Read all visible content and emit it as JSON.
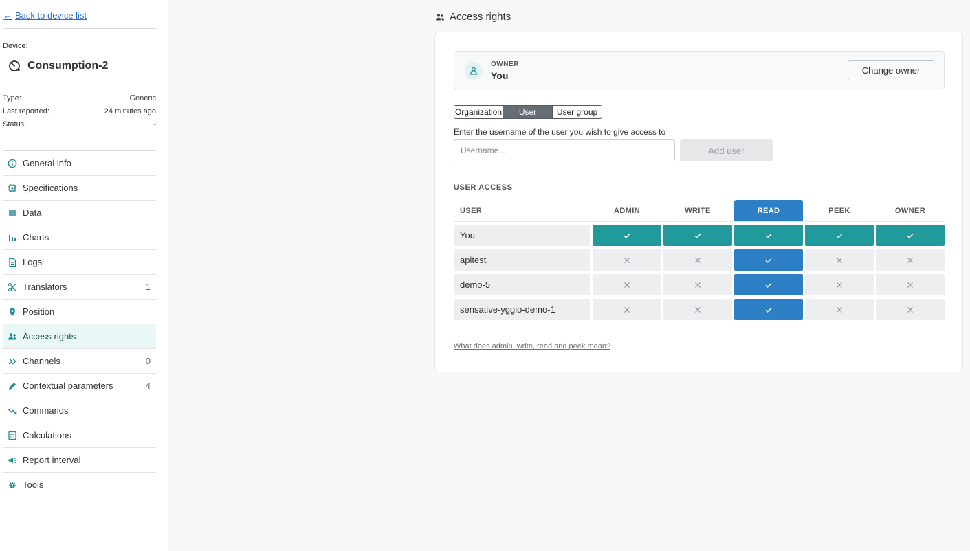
{
  "sidebar": {
    "back_label": "Back to device list",
    "device_label": "Device:",
    "device_name": "Consumption-2",
    "meta": [
      {
        "label": "Type:",
        "value": "Generic"
      },
      {
        "label": "Last reported:",
        "value": "24 minutes ago"
      },
      {
        "label": "Status:",
        "value": "-"
      }
    ],
    "items": [
      {
        "label": "General info",
        "icon": "info-icon",
        "count": ""
      },
      {
        "label": "Specifications",
        "icon": "chip-icon",
        "count": ""
      },
      {
        "label": "Data",
        "icon": "lines-icon",
        "count": ""
      },
      {
        "label": "Charts",
        "icon": "bar-chart-icon",
        "count": ""
      },
      {
        "label": "Logs",
        "icon": "document-icon",
        "count": ""
      },
      {
        "label": "Translators",
        "icon": "scissors-icon",
        "count": "1"
      },
      {
        "label": "Position",
        "icon": "location-pin-icon",
        "count": ""
      },
      {
        "label": "Access rights",
        "icon": "users-icon",
        "count": ""
      },
      {
        "label": "Channels",
        "icon": "double-chevron-icon",
        "count": "0"
      },
      {
        "label": "Contextual parameters",
        "icon": "pencil-icon",
        "count": "4"
      },
      {
        "label": "Commands",
        "icon": "trend-arrow-icon",
        "count": ""
      },
      {
        "label": "Calculations",
        "icon": "calculator-icon",
        "count": ""
      },
      {
        "label": "Report interval",
        "icon": "megaphone-icon",
        "count": ""
      },
      {
        "label": "Tools",
        "icon": "cog-icon",
        "count": ""
      }
    ],
    "active_index": 7
  },
  "main": {
    "section_title": "Access rights",
    "owner": {
      "label": "OWNER",
      "value": "You",
      "change_button": "Change owner"
    },
    "segments": [
      "Organization",
      "User",
      "User group"
    ],
    "active_segment": 1,
    "hint": "Enter the username of the user you wish to give access to",
    "username_placeholder": "Username...",
    "add_button": "Add user",
    "user_access_title": "USER ACCESS",
    "columns": [
      "USER",
      "ADMIN",
      "WRITE",
      "READ",
      "PEEK",
      "OWNER"
    ],
    "selected_column": "READ",
    "rows": [
      {
        "user": "You",
        "admin": true,
        "write": true,
        "read": true,
        "peek": true,
        "owner": true
      },
      {
        "user": "apitest",
        "admin": false,
        "write": false,
        "read": true,
        "peek": false,
        "owner": false
      },
      {
        "user": "demo-5",
        "admin": false,
        "write": false,
        "read": true,
        "peek": false,
        "owner": false
      },
      {
        "user": "sensative-yggio-demo-1",
        "admin": false,
        "write": false,
        "read": true,
        "peek": false,
        "owner": false
      }
    ],
    "help_link": "What does admin, write, read and peek mean?"
  },
  "colors": {
    "accent_teal": "#219a9b",
    "selected_blue": "#2d80c6",
    "link_blue": "#2a6fc9"
  }
}
